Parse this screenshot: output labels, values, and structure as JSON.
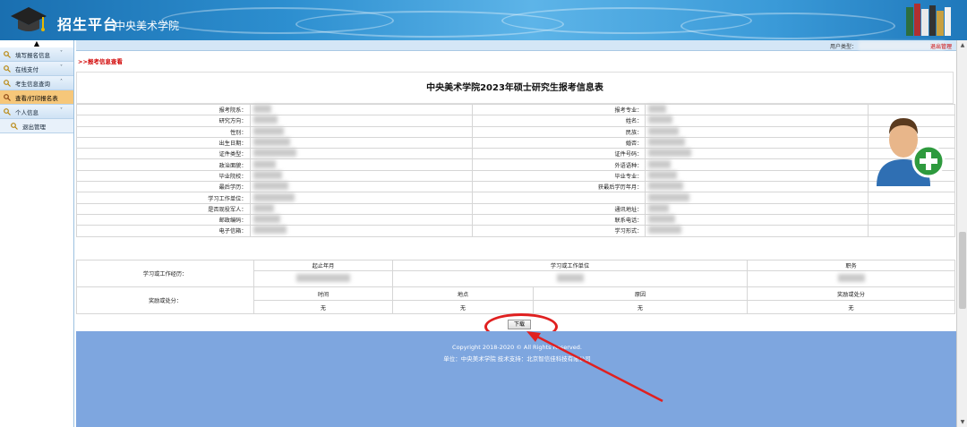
{
  "header": {
    "title_main": "招生平台",
    "title_sub": "中央美术学院"
  },
  "sidebar": {
    "items": [
      {
        "label": "填写报名信息",
        "arrow": "˅"
      },
      {
        "label": "在线支付",
        "arrow": "˅"
      },
      {
        "label": "考生信息查询",
        "arrow": "˄"
      },
      {
        "label": "查看/打印报名表",
        "arrow": ""
      },
      {
        "label": "个人信息",
        "arrow": "˅"
      },
      {
        "label": "退出管理",
        "arrow": ""
      }
    ]
  },
  "topbar": {
    "user_type_label": "用户类型：",
    "logout": "退出管理"
  },
  "breadcrumb": ">>报考信息查看",
  "form": {
    "title": "中央美术学院2023年硕士研究生报考信息表",
    "rows": [
      [
        "报考院系：",
        "报考专业："
      ],
      [
        "研究方向：",
        "姓名："
      ],
      [
        "性别：",
        "民族："
      ],
      [
        "出生日期：",
        "婚否："
      ],
      [
        "证件类型：",
        "证件号码："
      ],
      [
        "政治面貌：",
        "外语语种："
      ],
      [
        "毕业院校：",
        "毕业专业："
      ],
      [
        "最后学历：",
        "获最后学历年月："
      ],
      [
        "学习工作单位：",
        ""
      ],
      [
        "是否现役军人：",
        "通讯地址："
      ],
      [
        "邮政编码：",
        "联系电话："
      ],
      [
        "电子信箱：",
        "学习形式："
      ]
    ]
  },
  "history": {
    "work_label": "学习或工作经历：",
    "work_headers": [
      "起止年月",
      "学习或工作单位",
      "职务"
    ],
    "award_label": "奖励或处分：",
    "award_headers": [
      "时间",
      "地点",
      "原因",
      "奖励或处分"
    ],
    "award_values": [
      "无",
      "无",
      "无",
      "无"
    ]
  },
  "download_label": "下载",
  "footer": {
    "copyright": "Copyright 2018-2020 © All Rights Reserved.",
    "unit": "单位：中央美术学院   技术支持：北京智信佳科技有限公司"
  }
}
